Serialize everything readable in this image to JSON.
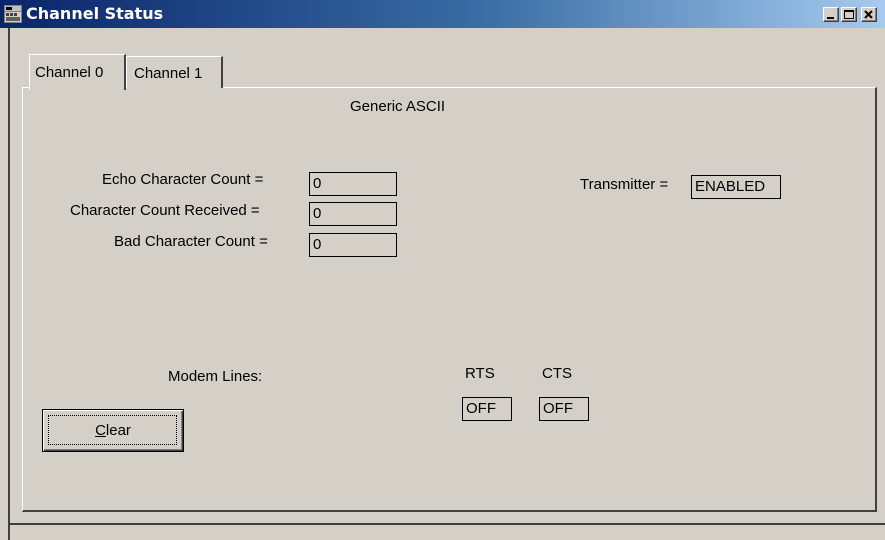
{
  "window": {
    "title": "Channel Status"
  },
  "tabs": [
    {
      "label": "Channel 0",
      "active": true
    },
    {
      "label": "Channel 1",
      "active": false
    }
  ],
  "panel": {
    "heading": "Generic ASCII",
    "counts": [
      {
        "label": "Echo Character Count =",
        "value": "0"
      },
      {
        "label": "Character Count Received =",
        "value": "0"
      },
      {
        "label": "Bad Character Count =",
        "value": "0"
      }
    ],
    "transmitter": {
      "label": "Transmitter =",
      "value": "ENABLED"
    },
    "modem": {
      "label": "Modem Lines:",
      "rts": {
        "label": "RTS",
        "value": "OFF"
      },
      "cts": {
        "label": "CTS",
        "value": "OFF"
      }
    },
    "clear_button": "Clear"
  }
}
